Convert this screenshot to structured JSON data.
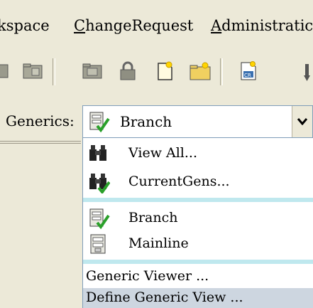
{
  "menubar": {
    "items": [
      {
        "prefix": "",
        "underline": "",
        "rest": "kspace"
      },
      {
        "prefix": "",
        "underline": "C",
        "rest": "hangeRequest"
      },
      {
        "prefix": "",
        "underline": "A",
        "rest": "dministratic"
      }
    ]
  },
  "toolbar": {
    "icons": [
      "node-icon",
      "folder-icon",
      "open-folder-icon",
      "lock-icon",
      "new-document-icon",
      "new-folder-icon",
      "change-request-icon",
      "arrow-icon"
    ]
  },
  "generics": {
    "label": "Generics:",
    "selected_value": "Branch",
    "dropdown_arrow": "chevron-down-icon"
  },
  "dropdown": {
    "group1": [
      {
        "label": "View All...",
        "icon": "binoculars-icon"
      },
      {
        "label": "CurrentGens...",
        "icon": "binoculars-green-icon"
      }
    ],
    "group2": [
      {
        "label": "Branch",
        "icon": "branch-icon"
      },
      {
        "label": "Mainline",
        "icon": "mainline-icon"
      }
    ],
    "group3": [
      {
        "label": "Generic Viewer ..."
      },
      {
        "label": "Define Generic View ..."
      }
    ]
  },
  "colors": {
    "background": "#ece9d8",
    "separator": "#bfe8ee",
    "selection": "#cdd6e0",
    "combo_border": "#7f9db9"
  }
}
